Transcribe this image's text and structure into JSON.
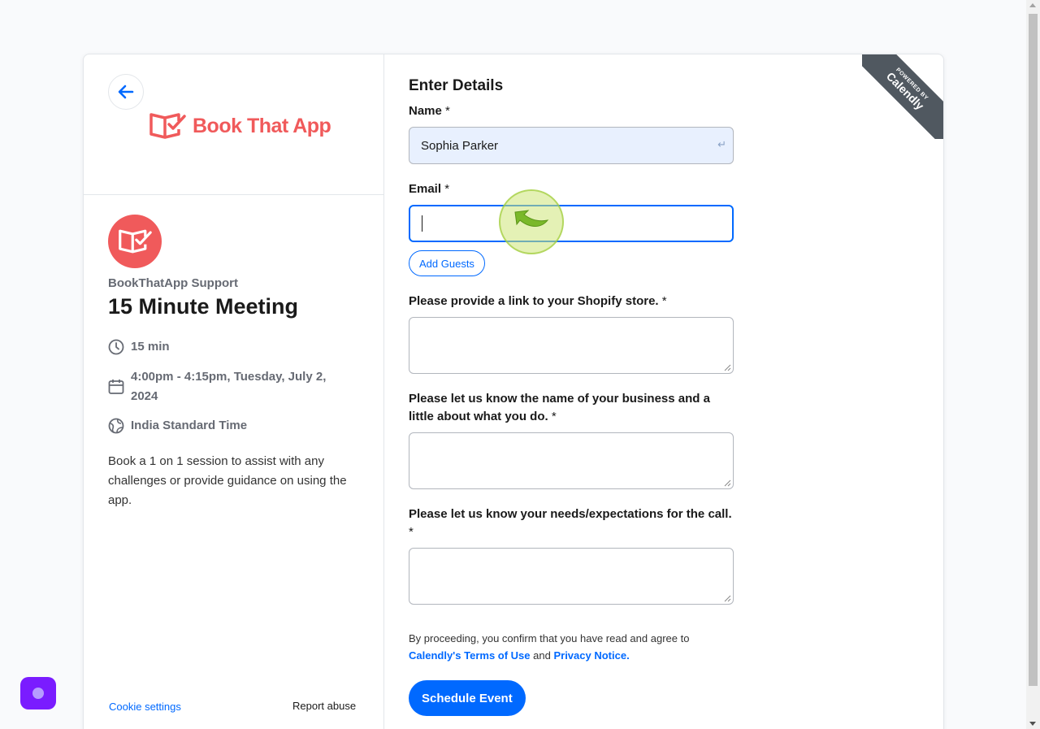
{
  "brand": {
    "name": "Book That App",
    "accent": "#f05a5b"
  },
  "event": {
    "host": "BookThatApp Support",
    "title": "15 Minute Meeting",
    "duration": "15 min",
    "datetime_line1": "4:00pm - 4:15pm, Tuesday, July 2,",
    "datetime_line2": "2024",
    "timezone": "India Standard Time",
    "description": "Book a 1 on 1 session to assist with any challenges or provide guidance on using the app."
  },
  "footer": {
    "cookie_settings": "Cookie settings",
    "report_abuse": "Report abuse"
  },
  "form": {
    "title": "Enter Details",
    "name_label": "Name",
    "name_value": "Sophia Parker",
    "email_label": "Email",
    "email_value": "",
    "required_mark": "*",
    "add_guests": "Add Guests",
    "q1_label": "Please provide a link to your Shopify store.",
    "q2_label": "Please let us know the name of your business and a little about what you do.",
    "q3_label": "Please let us know your needs/expectations for the call.",
    "consent_prefix": "By proceeding, you confirm that you have read and agree to",
    "terms_link": "Calendly's Terms of Use",
    "consent_and": "and",
    "privacy_link": "Privacy Notice.",
    "submit": "Schedule Event"
  },
  "ribbon": {
    "powered_by": "POWERED BY",
    "brand": "Calendly"
  },
  "colors": {
    "primary": "#0069ff",
    "chat": "#7a1cff"
  }
}
